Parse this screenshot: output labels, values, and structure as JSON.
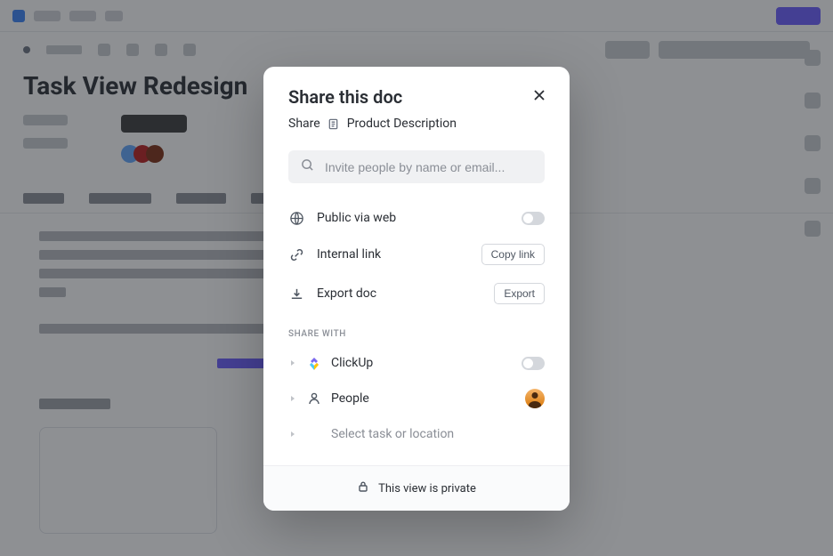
{
  "background": {
    "page_title": "Task View Redesign"
  },
  "modal": {
    "title": "Share this doc",
    "subtitle_prefix": "Share",
    "doc_name": "Product Description",
    "search_placeholder": "Invite people by name or email...",
    "options": {
      "public": {
        "label": "Public via web",
        "toggle": false
      },
      "internal": {
        "label": "Internal link",
        "button": "Copy link"
      },
      "export": {
        "label": "Export doc",
        "button": "Export"
      }
    },
    "share_with_label": "SHARE WITH",
    "share_rows": {
      "clickup": {
        "label": "ClickUp",
        "toggle": false
      },
      "people": {
        "label": "People"
      },
      "select": {
        "label": "Select task or location"
      }
    },
    "footer": "This view is private"
  }
}
